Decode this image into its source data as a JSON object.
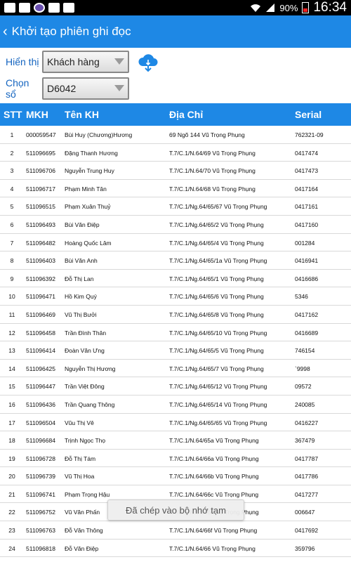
{
  "status_bar": {
    "battery": "90%",
    "time": "16:34",
    "icons": [
      "mail-icon",
      "image-icon",
      "viber-icon",
      "message-icon",
      "briefcase-icon",
      "wifi-icon",
      "signal-icon",
      "battery-icon"
    ]
  },
  "app_bar": {
    "back_icon": "chevron-left-icon",
    "title": "Khởi tạo phiên ghi đọc"
  },
  "controls": {
    "display_label": "Hiển thị",
    "display_value": "Khách hàng",
    "choose_label": "Chọn sổ",
    "choose_value": "D6042",
    "download_icon": "cloud-download-icon"
  },
  "table": {
    "headers": {
      "stt": "STT",
      "mkh": "MKH",
      "ten": "Tên KH",
      "dia": "Địa  Chỉ",
      "serial": "Serial"
    },
    "rows": [
      [
        "1",
        "000059547",
        "Bùi Huy (Chương)Hương",
        "69 Ngõ 144 Vũ Trọng Phụng",
        "762321-09"
      ],
      [
        "2",
        "511096695",
        "Đặng Thanh Hương",
        "T.7/C.1/N.64/69 Vũ Trọng Phụng",
        "0417474"
      ],
      [
        "3",
        "511096706",
        "Nguyễn Trung Huy",
        "T.7/C.1/N.64/70 Vũ Trọng Phụng",
        "0417473"
      ],
      [
        "4",
        "511096717",
        "Phạm Minh Tân",
        "T.7/C.1/N.64/68 Vũ Trọng Phụng",
        "0417164"
      ],
      [
        "5",
        "511096515",
        "Phạm Xuân Thuỷ",
        "T.7/C.1/Ng.64/65/67 Vũ Trọng Phụng",
        "0417161"
      ],
      [
        "6",
        "511096493",
        "Bùi Văn Điệp",
        "T.7/C.1/Ng.64/65/2 Vũ Trọng Phụng",
        "0417160"
      ],
      [
        "7",
        "511096482",
        "Hoàng Quốc Lâm",
        "T.7/C.1/Ng.64/65/4 Vũ Trọng Phụng",
        "001284"
      ],
      [
        "8",
        "511096403",
        "Bùi Văn Anh",
        "T.7/C.1/Ng.64/65/1a Vũ Trọng Phụng",
        "0416941"
      ],
      [
        "9",
        "511096392",
        "Đỗ Thị Lan",
        "T.7/C.1/Ng.64/65/1 Vũ Trọng Phụng",
        "0416686"
      ],
      [
        "10",
        "511096471",
        "Hồ Kim Quý",
        "T.7/C.1/Ng.64/65/6 Vũ Trọng Phụng",
        "5346"
      ],
      [
        "11",
        "511096469",
        "Vũ Thị Bưởi",
        "T.7/C.1/Ng.64/65/8 Vũ Trọng Phụng",
        "0417162"
      ],
      [
        "12",
        "511096458",
        "Trần Đình Thân",
        "T.7/C.1/Ng.64/65/10 Vũ Trọng Phụng",
        "0416689"
      ],
      [
        "13",
        "511096414",
        "Đoàn Văn Ưng",
        "T.7/C.1/Ng.64/65/5 Vũ Trọng Phụng",
        "746154"
      ],
      [
        "14",
        "511096425",
        "Nguyễn Thị Hương",
        "T.7/C.1/Ng.64/65/7 Vũ Trọng Phụng",
        "`9998"
      ],
      [
        "15",
        "511096447",
        "Trần Việt Đông",
        "T.7/C.1/Ng.64/65/12 Vũ Trọng Phụng",
        "09572"
      ],
      [
        "16",
        "511096436",
        "Trần Quang Thông",
        "T.7/C.1/Ng.64/65/14 Vũ Trọng Phụng",
        "240085"
      ],
      [
        "17",
        "511096504",
        "Vũu Thị Vê",
        "T.7/C.1/Ng.64/65/65 Vũ Trọng Phụng",
        "0416227"
      ],
      [
        "18",
        "511096684",
        "Trịnh Ngọc Thọ",
        "T.7/C.1/N.64/65a Vũ Trọng Phụng",
        "367479"
      ],
      [
        "19",
        "511096728",
        "Đỗ Thị Tám",
        "T.7/C.1/N.64/66a Vũ Trọng Phụng",
        "0417787"
      ],
      [
        "20",
        "511096739",
        "Vũ Thị Hoa",
        "T.7/C.1/N.64/66b Vũ Trọng Phụng",
        "0417786"
      ],
      [
        "21",
        "511096741",
        "Phạm Trọng Hậu",
        "T.7/C.1/N.64/66c Vũ Trọng Phụng",
        "0417277"
      ],
      [
        "22",
        "511096752",
        "Vũ Văn Phấn",
        "T.7/C.1/N.64/66d Vũ Trọng Phụng",
        "006647"
      ],
      [
        "23",
        "511096763",
        "Đỗ Văn Thông",
        "T.7/C.1/N.64/66f Vũ Trọng Phụng",
        "0417692"
      ],
      [
        "24",
        "511096818",
        "Đỗ Văn Điệp",
        "T.7/C.1/N.64/66 Vũ Trọng Phụng",
        "359796"
      ]
    ]
  },
  "toast": {
    "text": "Đã chép vào bộ nhớ tạm"
  },
  "colors": {
    "primary": "#1e88e5",
    "label": "#1565c0"
  }
}
